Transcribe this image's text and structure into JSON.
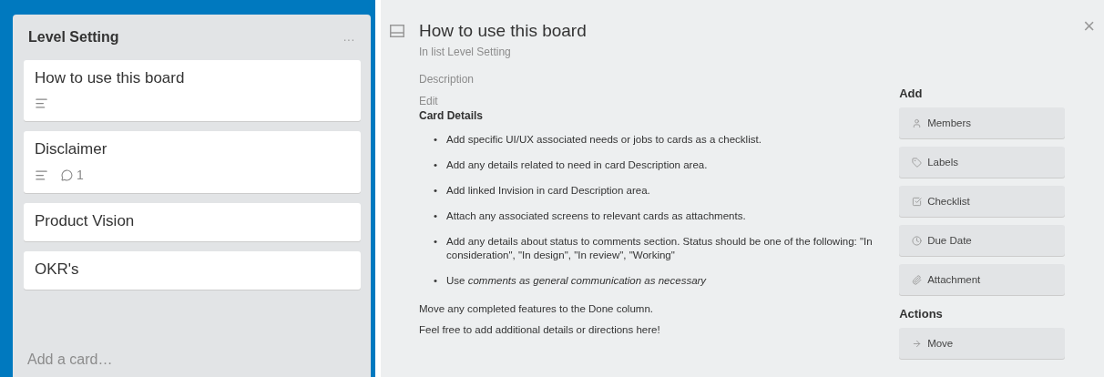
{
  "list": {
    "title": "Level Setting",
    "menu": "...",
    "cards": [
      {
        "title": "How to use this board",
        "badges": [
          {
            "kind": "description"
          }
        ]
      },
      {
        "title": "Disclaimer",
        "badges": [
          {
            "kind": "description"
          },
          {
            "kind": "comments",
            "count": "1"
          }
        ]
      },
      {
        "title": "Product Vision"
      },
      {
        "title": "OKR's"
      }
    ],
    "add_card": "Add a card…"
  },
  "card_detail": {
    "title": "How to use this board",
    "close": "×",
    "list_line": "In list Level Setting",
    "description_label": "Description",
    "edit_link": "Edit",
    "heading": "Card Details",
    "bullets": [
      {
        "marker": "•",
        "text": "Add specific UI/UX associated needs or jobs to cards as a checklist."
      },
      {
        "marker": "•",
        "text": "Add any details related to need in card Description area."
      },
      {
        "marker": "•",
        "text": "Add linked Invision in card Description area."
      },
      {
        "marker": "•",
        "text": "Attach any associated screens to relevant cards as attachments."
      },
      {
        "marker": "•",
        "text": "Add any details about status to comments section. Status should be one of the following: \"In consideration\", \"In design\", \"In review\", \"Working\""
      },
      {
        "marker": "•",
        "text": "Use *comments as general communication as necessary*"
      }
    ],
    "paragraphs": [
      "Move any completed features to the Done column.",
      "Feel free to add additional details or directions here!"
    ],
    "sidebar": [
      {
        "heading": "Add",
        "buttons": [
          {
            "kind": "members",
            "label": "Members"
          },
          {
            "kind": "labels",
            "label": "Labels"
          },
          {
            "kind": "checklist",
            "label": "Checklist"
          },
          {
            "kind": "due",
            "label": "Due Date"
          },
          {
            "kind": "attachment",
            "label": "Attachment"
          }
        ]
      },
      {
        "heading": "Actions",
        "buttons": [
          {
            "kind": "move",
            "label": "Move"
          }
        ]
      }
    ]
  }
}
